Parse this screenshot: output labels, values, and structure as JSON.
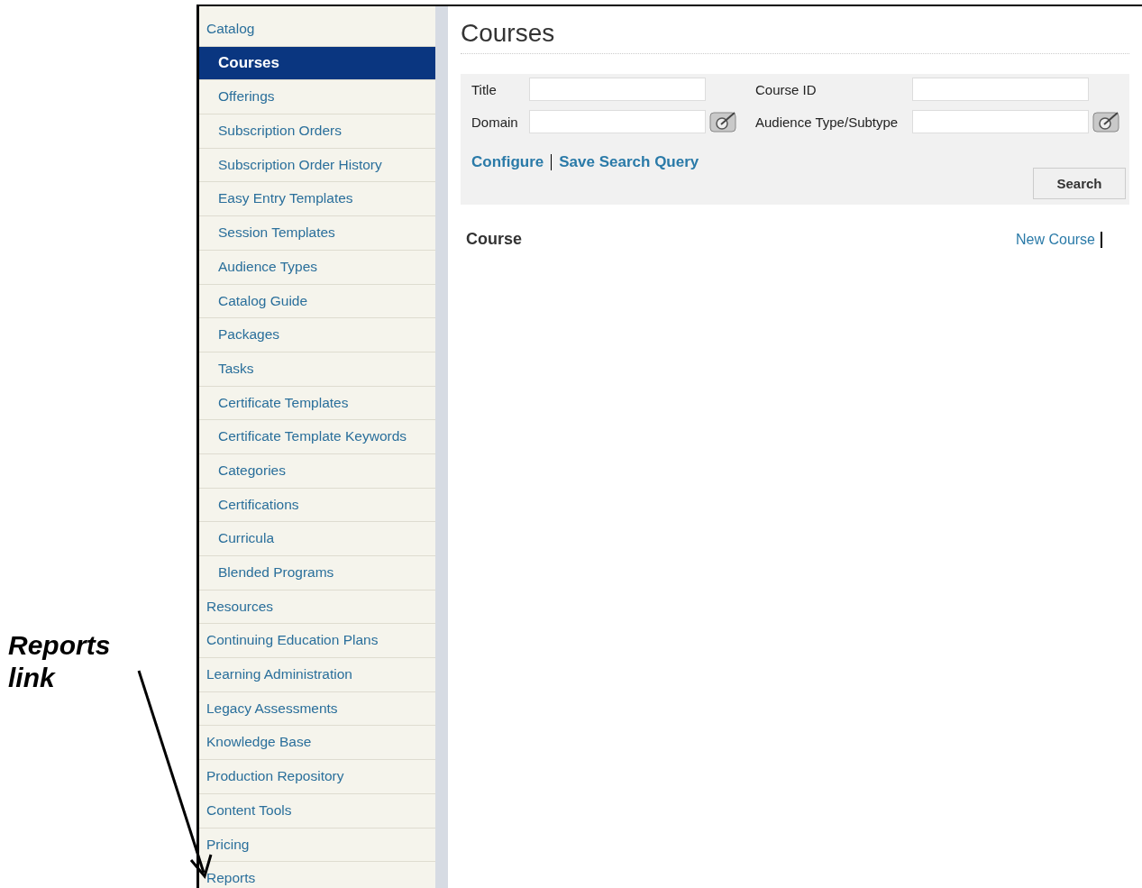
{
  "annotation": {
    "text": "Reports link"
  },
  "sidebar": {
    "items": [
      {
        "label": "Catalog",
        "selected": false,
        "children": [
          {
            "label": "Courses",
            "selected": true
          },
          {
            "label": "Offerings",
            "selected": false
          },
          {
            "label": "Subscription Orders",
            "selected": false
          },
          {
            "label": "Subscription Order History",
            "selected": false
          },
          {
            "label": "Easy Entry Templates",
            "selected": false
          },
          {
            "label": "Session Templates",
            "selected": false
          },
          {
            "label": "Audience Types",
            "selected": false
          },
          {
            "label": "Catalog Guide",
            "selected": false
          },
          {
            "label": "Packages",
            "selected": false
          },
          {
            "label": "Tasks",
            "selected": false
          },
          {
            "label": "Certificate Templates",
            "selected": false
          },
          {
            "label": "Certificate Template Keywords",
            "selected": false
          },
          {
            "label": "Categories",
            "selected": false
          },
          {
            "label": "Certifications",
            "selected": false
          },
          {
            "label": "Curricula",
            "selected": false
          },
          {
            "label": "Blended Programs",
            "selected": false
          }
        ]
      },
      {
        "label": "Resources",
        "selected": false
      },
      {
        "label": "Continuing Education Plans",
        "selected": false
      },
      {
        "label": "Learning Administration",
        "selected": false
      },
      {
        "label": "Legacy Assessments",
        "selected": false
      },
      {
        "label": "Knowledge Base",
        "selected": false
      },
      {
        "label": "Production Repository",
        "selected": false
      },
      {
        "label": "Content Tools",
        "selected": false
      },
      {
        "label": "Pricing",
        "selected": false
      },
      {
        "label": "Reports",
        "selected": false
      }
    ]
  },
  "page_title": "Courses",
  "search_form": {
    "fields": [
      {
        "label": "Title",
        "picker": false
      },
      {
        "label": "Course ID",
        "picker": false
      },
      {
        "label": "Domain",
        "picker": true
      },
      {
        "label": "Audience Type/Subtype",
        "picker": true
      }
    ],
    "links": [
      "Configure",
      "Save Search Query"
    ],
    "search_button": "Search"
  },
  "results": {
    "heading": "Course",
    "links": [
      "New Course"
    ]
  }
}
